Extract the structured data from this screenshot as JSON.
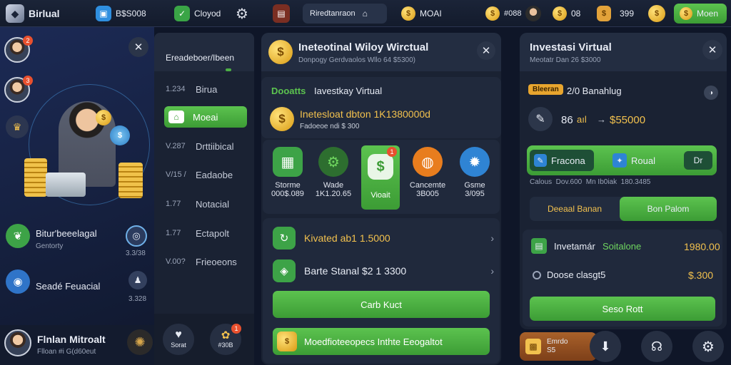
{
  "topbar": {
    "app_name": "Birlual",
    "balance1": "B$S008",
    "brand": "Cloyod",
    "promo": "Riredtanraon",
    "coin_text": "MOAI",
    "coin_count": "#088",
    "gems": "08",
    "tickets": "399",
    "menu_label": "Moen"
  },
  "left": {
    "item1_title": "Bitur'beeelagal",
    "item1_sub": "Gentorty",
    "item1_value": "3.3/38",
    "item2_title": "Seadé Feuacial",
    "item2_value": "3.328",
    "user_name": "Flnlan Mitroalt",
    "user_sub": "Flloan #i G(d60eut"
  },
  "sidebar": {
    "header": "Ereadeboer/Ibeen",
    "items": [
      {
        "num": "1.234",
        "label": "Birua"
      },
      {
        "num": "",
        "label": "Moeai"
      },
      {
        "num": "V.287",
        "label": "Drttiibical"
      },
      {
        "num": "V/15 /",
        "label": "Eadaobe"
      },
      {
        "num": "1.77",
        "label": "Notacial"
      },
      {
        "num": "1.77",
        "label": "Ectapolt"
      },
      {
        "num": "V.00?",
        "label": "Frieoeons"
      }
    ],
    "btn1": "Sorat",
    "btn2": "#30B",
    "badge": "1"
  },
  "center": {
    "title": "Ineteotinal Wiloy Wirctual",
    "subtitle": "Donpogy Gerdvaolos Wllo 64 $5300)",
    "section_a": "Dooatts",
    "section_b": "Iavestkay Virtual",
    "amount": "Inetesloat dbton 1K1380000d",
    "amount_sub": "Fadoeoe ndi $ 300",
    "tiles": [
      {
        "name": "Storme",
        "value": "000$.089"
      },
      {
        "name": "Wade",
        "value": "1K1.20.65"
      },
      {
        "name": "Vioait",
        "value": ""
      },
      {
        "name": "Cancemte",
        "value": "3B005"
      },
      {
        "name": "Gsme",
        "value": "3/095"
      }
    ],
    "tile_badge": "1",
    "row1": "Kivated ab1 1.5000",
    "row2": "Barte Stanal $2 1 3300",
    "btn_main": "Carb Kuct",
    "btn_second": "Moedfioteeopecs Inthte Eeogaltot"
  },
  "right": {
    "title": "Investasi Virtual",
    "subtitle": "Meotatr Dan 26 $3000",
    "tag": "Bleeran",
    "tag_text": "2/0 Banahlug",
    "price_left": "86",
    "price_mid": "aıl",
    "price_right": "$55000",
    "pill_left": "Fracona",
    "pill_right": "Roual",
    "pill_end": "Dr",
    "legend": "Calous  Dov.600  Mn Ib0iak  180.3485",
    "tab_a": "Deeaal Banan",
    "tab_b": "Bon Palom",
    "inv_label": "Invetamár",
    "inv_label_green": "Soitalone",
    "inv_value": "1980.00",
    "dose_label": "Doose clasgt5",
    "dose_value": "$.300",
    "btn": "Seso Rott",
    "bottom_tag": "Emrdo",
    "bottom_tag_sub": "S5"
  },
  "colors": {
    "green": "#4caf45",
    "gold": "#f2c14e",
    "panel": "#1d2638"
  }
}
